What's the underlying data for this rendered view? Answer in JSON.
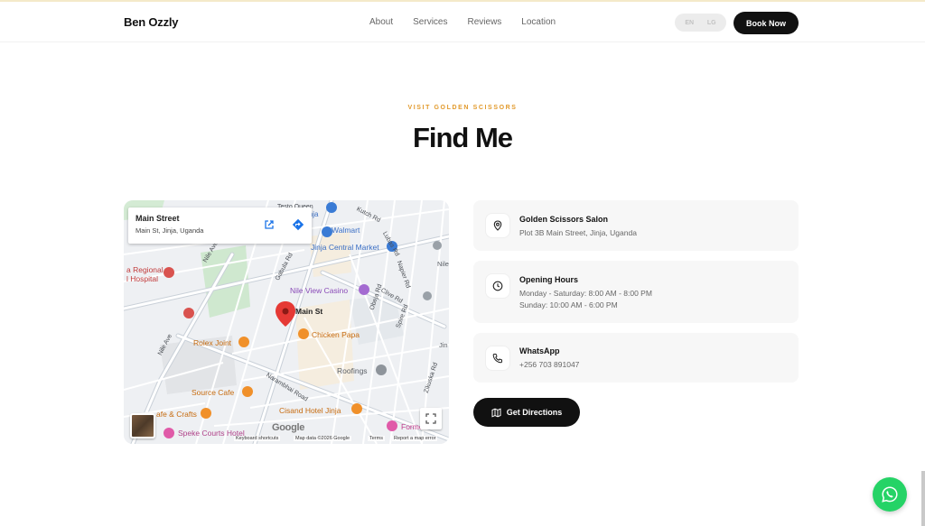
{
  "brand": "Ben Ozzly",
  "nav": {
    "items": [
      "About",
      "Services",
      "Reviews",
      "Location"
    ]
  },
  "lang": {
    "options": [
      "EN",
      "LG"
    ]
  },
  "book_label": "Book Now",
  "section": {
    "eyebrow": "VISIT GOLDEN SCISSORS",
    "title": "Find Me"
  },
  "map": {
    "card_title": "Main Street",
    "card_address": "Main St, Jinja, Uganda",
    "pin_label": "Main St",
    "places": {
      "testo": "Testo Queen",
      "jinja_short": "Jinja",
      "kutch": "Kutch Rd",
      "walmart": "Walmart",
      "lubas": "Lubas Rd",
      "central_market": "Jinja Central Market",
      "regional1": "a Regional",
      "regional2": "l Hospital",
      "nile_ave_1": "Nile Ave",
      "gabula": "Gabula Rd",
      "napier": "Napier Rd",
      "nile_view": "Nile View Casino",
      "clive": "Clive Rd",
      "obeja": "Obeja Rd",
      "spire": "Spire Rd",
      "chicken": "Chicken Papa",
      "rolex": "Rolex Joint",
      "nile_ave_2": "Nile Ave",
      "narambhai": "Narambhai Road",
      "roofings": "Roofings",
      "zikuska": "Zikuska Rd",
      "source_cafe": "Source Cafe",
      "crafts": "afe & Crafts",
      "cisand": "Cisand Hotel Jinja",
      "speke": "Speke Courts Hotel",
      "forme": "Forme On",
      "nile_edge": "Nile",
      "jin_edge": "Jin"
    },
    "google": "Google",
    "footer": {
      "shortcuts": "Keyboard shortcuts",
      "data": "Map data ©2026 Google",
      "terms": "Terms",
      "report": "Report a map error"
    }
  },
  "cards": [
    {
      "title": "Golden Scissors Salon",
      "lines": [
        "Plot 3B Main Street, Jinja, Uganda"
      ]
    },
    {
      "title": "Opening Hours",
      "lines": [
        "Monday - Saturday: 8:00 AM - 8:00 PM",
        "Sunday: 10:00 AM - 6:00 PM"
      ]
    },
    {
      "title": "WhatsApp",
      "lines": [
        "+256 703 891047"
      ]
    }
  ],
  "directions_label": "Get Directions",
  "colors": {
    "accent": "#e29a2c",
    "dark": "#111111",
    "whatsapp": "#25d366",
    "pin": "#e53935"
  }
}
